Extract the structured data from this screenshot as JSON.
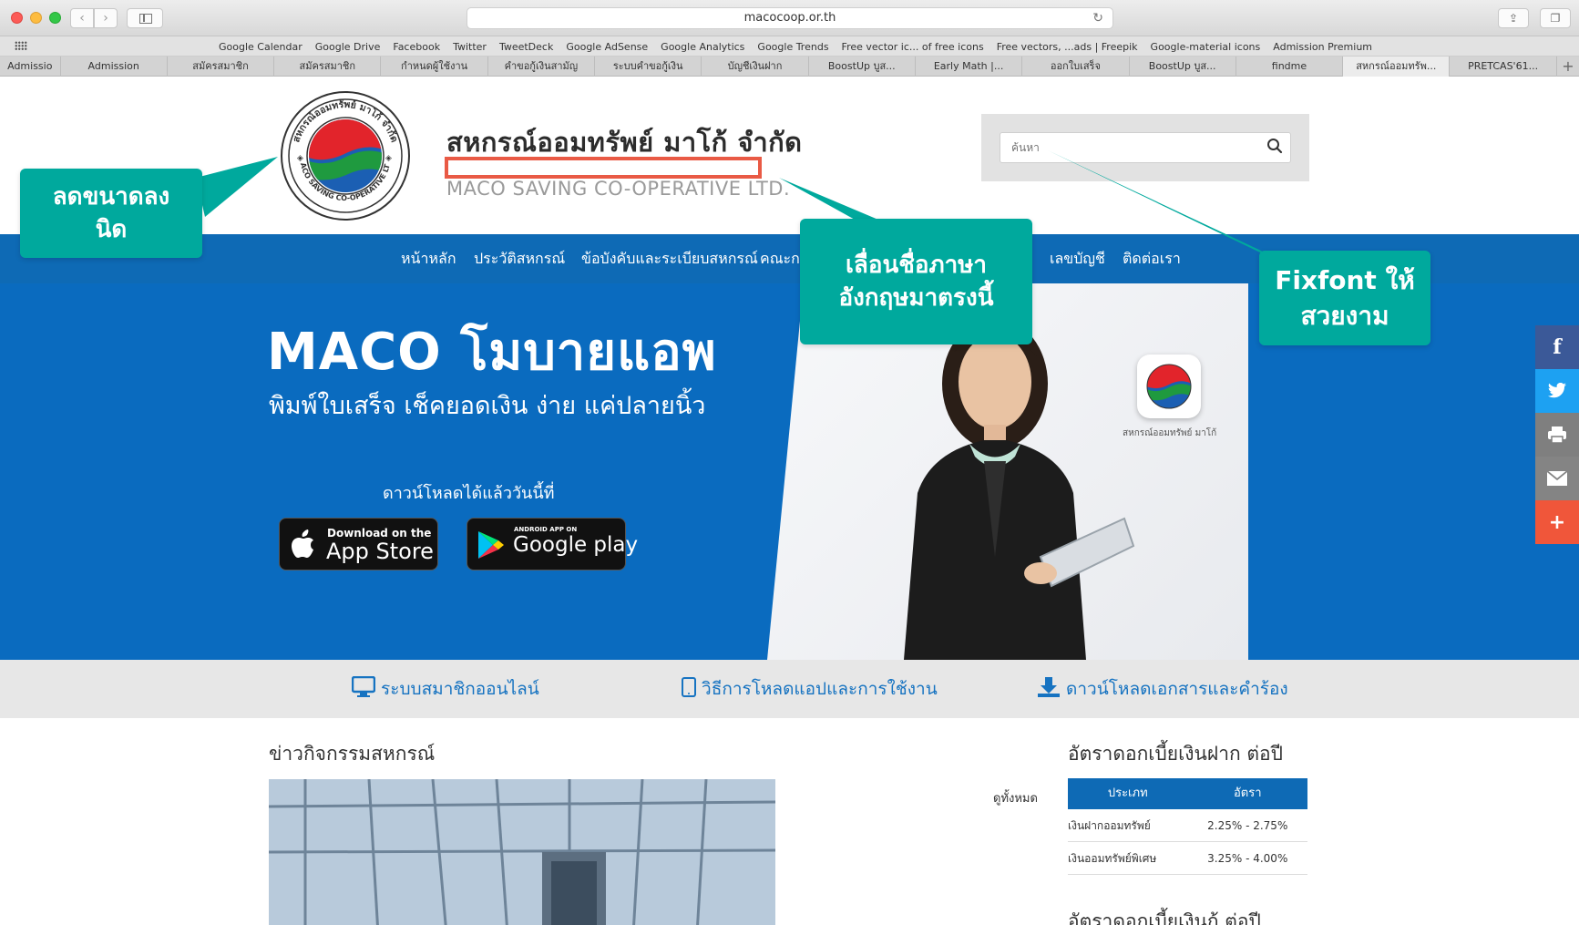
{
  "browser": {
    "url": "macocoop.or.th",
    "bookmarks": [
      "Google Calendar",
      "Google Drive",
      "Facebook",
      "Twitter",
      "TweetDeck",
      "Google AdSense",
      "Google Analytics",
      "Google Trends",
      "Free vector ic... of free icons",
      "Free vectors, ...ads | Freepik",
      "Google-material icons",
      "Admission Premium"
    ],
    "tabs": [
      "Admissio",
      "Admission",
      "สมัครสมาชิก",
      "สมัครสมาชิก",
      "กำหนดผู้ใช้งาน",
      "คำขอกู้เงินสามัญ",
      "ระบบคำขอกู้เงิน",
      "บัญชีเงินฝาก",
      "BoostUp บูส...",
      "Early Math |...",
      "ออกใบเสร็จ",
      "BoostUp บูส...",
      "findme",
      "สหกรณ์ออมทรัพ...",
      "PRETCAS'61..."
    ],
    "active_tab_index": 13
  },
  "header": {
    "title": "สหกรณ์ออมทรัพย์ มาโก้ จำกัด",
    "subtitle": "MACO SAVING CO-OPERATIVE LTD.",
    "search_placeholder": "ค้นหา",
    "logo_text": "สหกรณ์ออมทรัพย์ มาโก้ จำกัด MACO SAVING CO-OPERATIVE LTD."
  },
  "menu": {
    "home": "หน้าหลัก",
    "history": "ประวัติสหกรณ์",
    "rules": "ข้อบังคับและระเบียบสหกรณ์",
    "board": "คณะก",
    "accounts": "เลขบัญชี",
    "contact": "ติดต่อเรา"
  },
  "hero": {
    "title": "MACO โมบายแอพ",
    "subtitle": "พิมพ์ใบเสร็จ เช็คยอดเงิน ง่าย แค่ปลายนิ้ว",
    "download_now": "ดาวน์โหลดได้แล้ววันนี้ที่",
    "appstore_small": "Download on the",
    "appstore_big": "App Store",
    "google_small": "ANDROID APP ON",
    "google_big": "Google play",
    "app_caption": "สหกรณ์ออมทรัพย์ มาโก้"
  },
  "quick_links": {
    "member": "ระบบสมาชิกออนไลน์",
    "howto": "วิธีการโหลดแอปและการใช้งาน",
    "docs": "ดาวน์โหลดเอกสารและคำร้อง"
  },
  "news": {
    "title": "ข่าวกิจกรรมสหกรณ์",
    "see_all": "ดูทั้งหมด"
  },
  "rates": {
    "title": "อัตราดอกเบี้ยเงินฝาก ต่อปี",
    "col_type": "ประเภท",
    "col_rate": "อัตรา",
    "rows": [
      {
        "type": "เงินฝากออมทรัพย์",
        "rate": "2.25% - 2.75%"
      },
      {
        "type": "เงินออมทรัพย์พิเศษ",
        "rate": "3.25% - 4.00%"
      }
    ],
    "title2": "อัตราดอกเบี้ยเงินกู้ ต่อปี"
  },
  "annotations": {
    "shrink": "ลดขนาดลง\nนิด",
    "move_english": "เลื่อนชื่อภาษา\nอังกฤษมาตรงนี้",
    "fixfont": "Fixfont ให้\nสวยงาม"
  },
  "colors": {
    "brand_blue": "#0e6ab5",
    "callout_teal": "#00a99d",
    "highlight_red": "#e95a45",
    "facebook": "#3b5998",
    "twitter": "#1da1f2",
    "print": "#7f7f7f",
    "email": "#848484",
    "more": "#f0563a"
  }
}
